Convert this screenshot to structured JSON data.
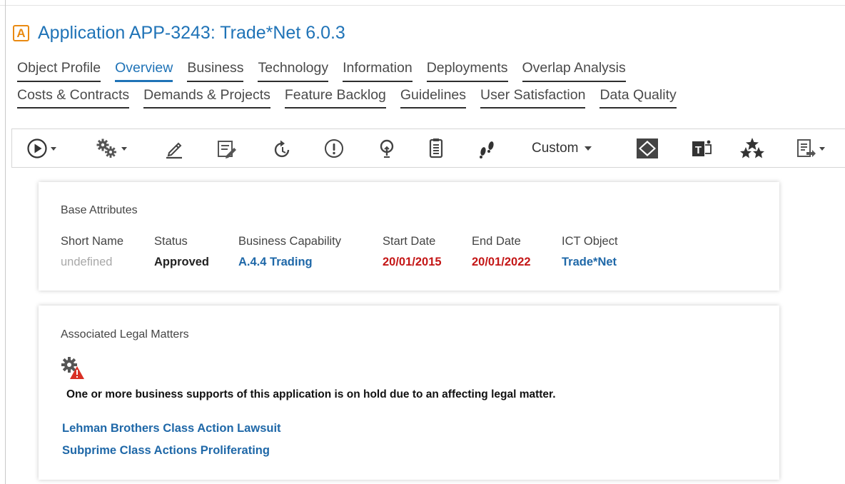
{
  "header": {
    "badge": "A",
    "title": "Application APP-3243: Trade*Net 6.0.3"
  },
  "tabs": {
    "row1": [
      "Object Profile",
      "Overview",
      "Business",
      "Technology",
      "Information",
      "Deployments",
      "Overlap Analysis"
    ],
    "row2": [
      "Costs & Contracts",
      "Demands & Projects",
      "Feature Backlog",
      "Guidelines",
      "User Satisfaction",
      "Data Quality"
    ],
    "active": "Overview"
  },
  "toolbar": {
    "icons": [
      "play-menu-icon",
      "settings-menu-icon",
      "edit-pencil-icon",
      "edit-form-icon",
      "refresh-icon",
      "alert-icon",
      "lightbulb-icon",
      "clipboard-icon",
      "footsteps-icon",
      "diamond-icon",
      "teams-icon",
      "stars-icon",
      "export-menu-icon"
    ],
    "custom_label": "Custom"
  },
  "base_attributes": {
    "title": "Base Attributes",
    "short_name": {
      "label": "Short Name",
      "value": "undefined"
    },
    "status": {
      "label": "Status",
      "value": "Approved"
    },
    "business_capability": {
      "label": "Business Capability",
      "value": "A.4.4 Trading"
    },
    "start_date": {
      "label": "Start Date",
      "value": "20/01/2015"
    },
    "end_date": {
      "label": "End Date",
      "value": "20/01/2022"
    },
    "ict_object": {
      "label": "ICT Object",
      "value": "Trade*Net"
    }
  },
  "legal": {
    "title": "Associated Legal Matters",
    "warning": "One or more business supports of this application is on hold due to an affecting legal matter.",
    "matters": [
      "Lehman Brothers Class Action Lawsuit",
      "Subprime Class Actions Proliferating"
    ]
  },
  "colors": {
    "link": "#1f68a8",
    "title_blue": "#1f73b7",
    "date_red": "#c41717",
    "badge_orange": "#e98a12",
    "warning_red": "#d93025"
  }
}
